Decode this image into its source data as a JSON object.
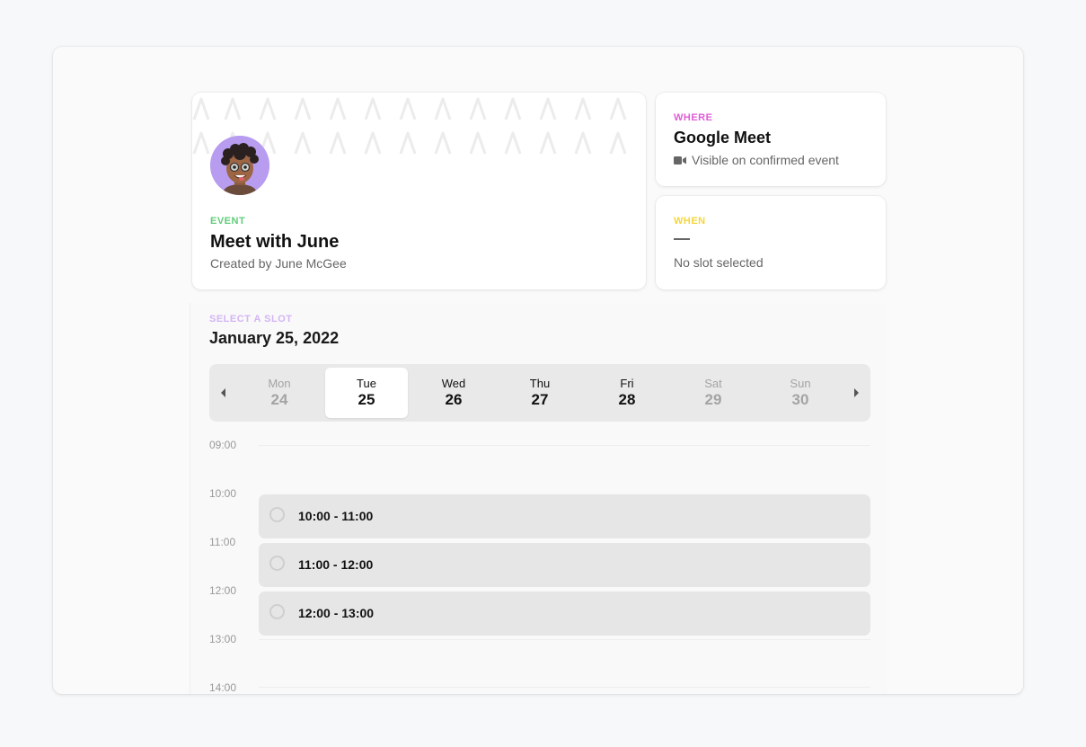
{
  "event": {
    "tag": "EVENT",
    "title": "Meet with June",
    "created_by": "Created by June McGee",
    "avatar_icon": "memoji-avatar",
    "tag_color": "#5fce78"
  },
  "where": {
    "tag": "WHERE",
    "title": "Google Meet",
    "subtitle": "Visible on confirmed event",
    "icon": "video-camera-icon",
    "tag_color": "#e05bd8"
  },
  "when": {
    "tag": "WHEN",
    "status": "No slot selected",
    "tag_color": "#f5d63d"
  },
  "slots_section": {
    "tag": "SELECT A SLOT",
    "date": "January 25, 2022",
    "tag_color": "#d3b5f5"
  },
  "days": [
    {
      "name": "Mon",
      "num": "24",
      "state": "dim"
    },
    {
      "name": "Tue",
      "num": "25",
      "state": "active"
    },
    {
      "name": "Wed",
      "num": "26",
      "state": "normal"
    },
    {
      "name": "Thu",
      "num": "27",
      "state": "normal"
    },
    {
      "name": "Fri",
      "num": "28",
      "state": "normal"
    },
    {
      "name": "Sat",
      "num": "29",
      "state": "dim"
    },
    {
      "name": "Sun",
      "num": "30",
      "state": "dim"
    }
  ],
  "times": [
    "09:00",
    "10:00",
    "11:00",
    "12:00",
    "13:00",
    "14:00"
  ],
  "slots": [
    {
      "label": "10:00 - 11:00"
    },
    {
      "label": "11:00 - 12:00"
    },
    {
      "label": "12:00 - 13:00"
    }
  ]
}
